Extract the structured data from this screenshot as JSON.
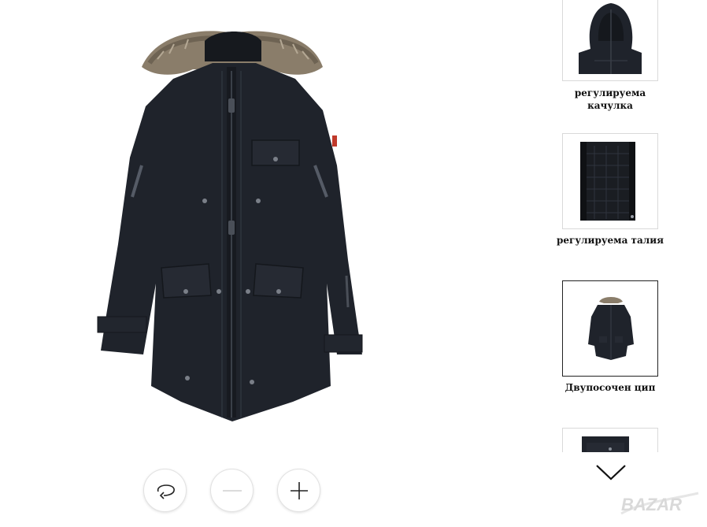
{
  "product": {
    "main_image_icon": "parka-jacket-image"
  },
  "controls": {
    "reset_icon": "rotate-reset-icon",
    "zoom_out_icon": "minus-icon",
    "zoom_in_icon": "plus-icon"
  },
  "thumbnails": [
    {
      "label": "регулируема\nкачулка",
      "icon": "hood-detail-image",
      "active": false
    },
    {
      "label": "регулируема талия",
      "icon": "inner-lining-image",
      "active": false
    },
    {
      "label": "Двупосочен цип",
      "icon": "full-jacket-image",
      "active": true
    },
    {
      "label": "",
      "icon": "pocket-detail-image",
      "active": false
    }
  ],
  "watermark": {
    "text": "BAZAR"
  },
  "colors": {
    "jacket": "#1f232b",
    "fur": "#8a7d6a",
    "active_border": "#222222",
    "thumb_border": "#d9d9d9"
  }
}
